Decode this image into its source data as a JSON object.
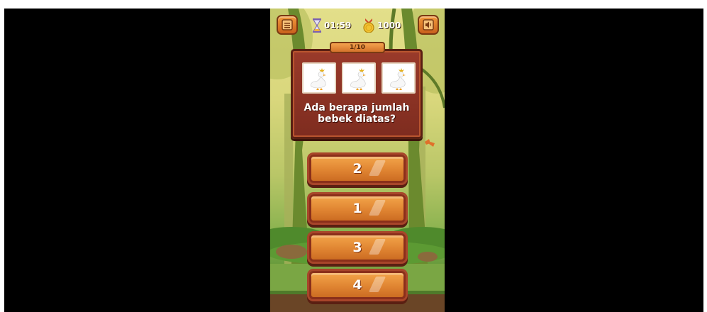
{
  "hud": {
    "timer": "01:59",
    "coins": "1000",
    "icons": {
      "menu": "menu-icon",
      "timer": "hourglass-icon",
      "coins": "coin-icon",
      "sound": "speaker-icon"
    }
  },
  "question": {
    "counter": "1/10",
    "text": "Ada berapa jumlah bebek diatas?",
    "images": [
      "duck",
      "duck",
      "duck"
    ]
  },
  "answers": [
    "2",
    "1",
    "3",
    "4"
  ],
  "colors": {
    "button_orange": "#e08532",
    "board_red": "#8a3224",
    "border_brown": "#5a1f12"
  }
}
